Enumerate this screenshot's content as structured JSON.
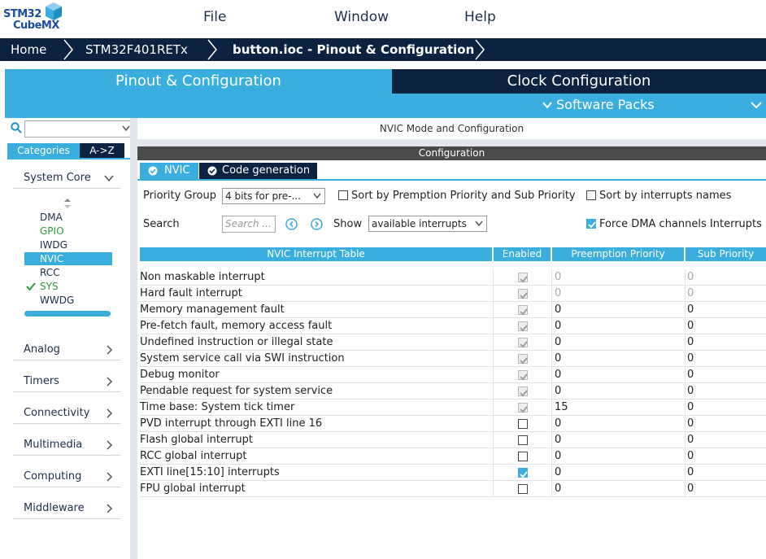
{
  "app": {
    "logo_line1": "STM32",
    "logo_line2": "CubeMX",
    "menu": [
      "File",
      "Window",
      "Help"
    ]
  },
  "breadcrumb": [
    "Home",
    "STM32F401RETx",
    "button.ioc - Pinout & Configuration"
  ],
  "main_tabs": {
    "pinout": "Pinout & Configuration",
    "clock": "Clock Configuration",
    "software_packs": "Software Packs"
  },
  "left": {
    "search_value": "",
    "cat_tabs": [
      "Categories",
      "A->Z"
    ],
    "groups_top": "System Core",
    "system_core_items": [
      {
        "label": "DMA",
        "state": "normal"
      },
      {
        "label": "GPIO",
        "state": "green"
      },
      {
        "label": "IWDG",
        "state": "normal"
      },
      {
        "label": "NVIC",
        "state": "selected"
      },
      {
        "label": "RCC",
        "state": "normal"
      },
      {
        "label": "SYS",
        "state": "checked"
      },
      {
        "label": "WWDG",
        "state": "normal"
      }
    ],
    "groups": [
      "Analog",
      "Timers",
      "Connectivity",
      "Multimedia",
      "Computing",
      "Middleware"
    ]
  },
  "right": {
    "mode_title": "NVIC Mode and Configuration",
    "configuration": "Configuration",
    "subtabs": [
      "NVIC",
      "Code generation"
    ],
    "priority_group_label": "Priority Group",
    "priority_group_value": "4 bits for pre-...",
    "sort_premption": "Sort by Premption Priority and Sub Priority",
    "sort_names": "Sort by interrupts names",
    "search_label": "Search",
    "search_placeholder": "Search ...",
    "show_label": "Show",
    "show_value": "available interrupts",
    "force_dma": "Force DMA channels Interrupts",
    "force_dma_checked": true,
    "sort_premption_checked": false,
    "sort_names_checked": false
  },
  "table": {
    "headers": [
      "NVIC Interrupt Table",
      "Enabled",
      "Preemption Priority",
      "Sub Priority"
    ],
    "rows": [
      {
        "name": "Non maskable interrupt",
        "enabled": "checked-locked",
        "pre": "0",
        "sub": "0",
        "dim": true
      },
      {
        "name": "Hard fault interrupt",
        "enabled": "checked-locked",
        "pre": "0",
        "sub": "0",
        "dim": true
      },
      {
        "name": "Memory management fault",
        "enabled": "checked-locked",
        "pre": "0",
        "sub": "0",
        "dim": false
      },
      {
        "name": "Pre-fetch fault, memory access fault",
        "enabled": "checked-locked",
        "pre": "0",
        "sub": "0",
        "dim": false
      },
      {
        "name": "Undefined instruction or illegal state",
        "enabled": "checked-locked",
        "pre": "0",
        "sub": "0",
        "dim": false
      },
      {
        "name": "System service call via SWI instruction",
        "enabled": "checked-locked",
        "pre": "0",
        "sub": "0",
        "dim": false
      },
      {
        "name": "Debug monitor",
        "enabled": "checked-locked",
        "pre": "0",
        "sub": "0",
        "dim": false
      },
      {
        "name": "Pendable request for system service",
        "enabled": "checked-locked",
        "pre": "0",
        "sub": "0",
        "dim": false
      },
      {
        "name": "Time base: System tick timer",
        "enabled": "checked-locked",
        "pre": "15",
        "sub": "0",
        "dim": false
      },
      {
        "name": "PVD interrupt through EXTI line 16",
        "enabled": "unchecked",
        "pre": "0",
        "sub": "0",
        "dim": false
      },
      {
        "name": "Flash global interrupt",
        "enabled": "unchecked",
        "pre": "0",
        "sub": "0",
        "dim": false
      },
      {
        "name": "RCC global interrupt",
        "enabled": "unchecked",
        "pre": "0",
        "sub": "0",
        "dim": false
      },
      {
        "name": "EXTI line[15:10] interrupts",
        "enabled": "checked",
        "pre": "0",
        "sub": "0",
        "dim": false
      },
      {
        "name": "FPU global interrupt",
        "enabled": "unchecked",
        "pre": "0",
        "sub": "0",
        "dim": false
      }
    ]
  },
  "colors": {
    "accent": "#3aaede",
    "navy": "#0b2341",
    "green": "#2e9b3a"
  }
}
